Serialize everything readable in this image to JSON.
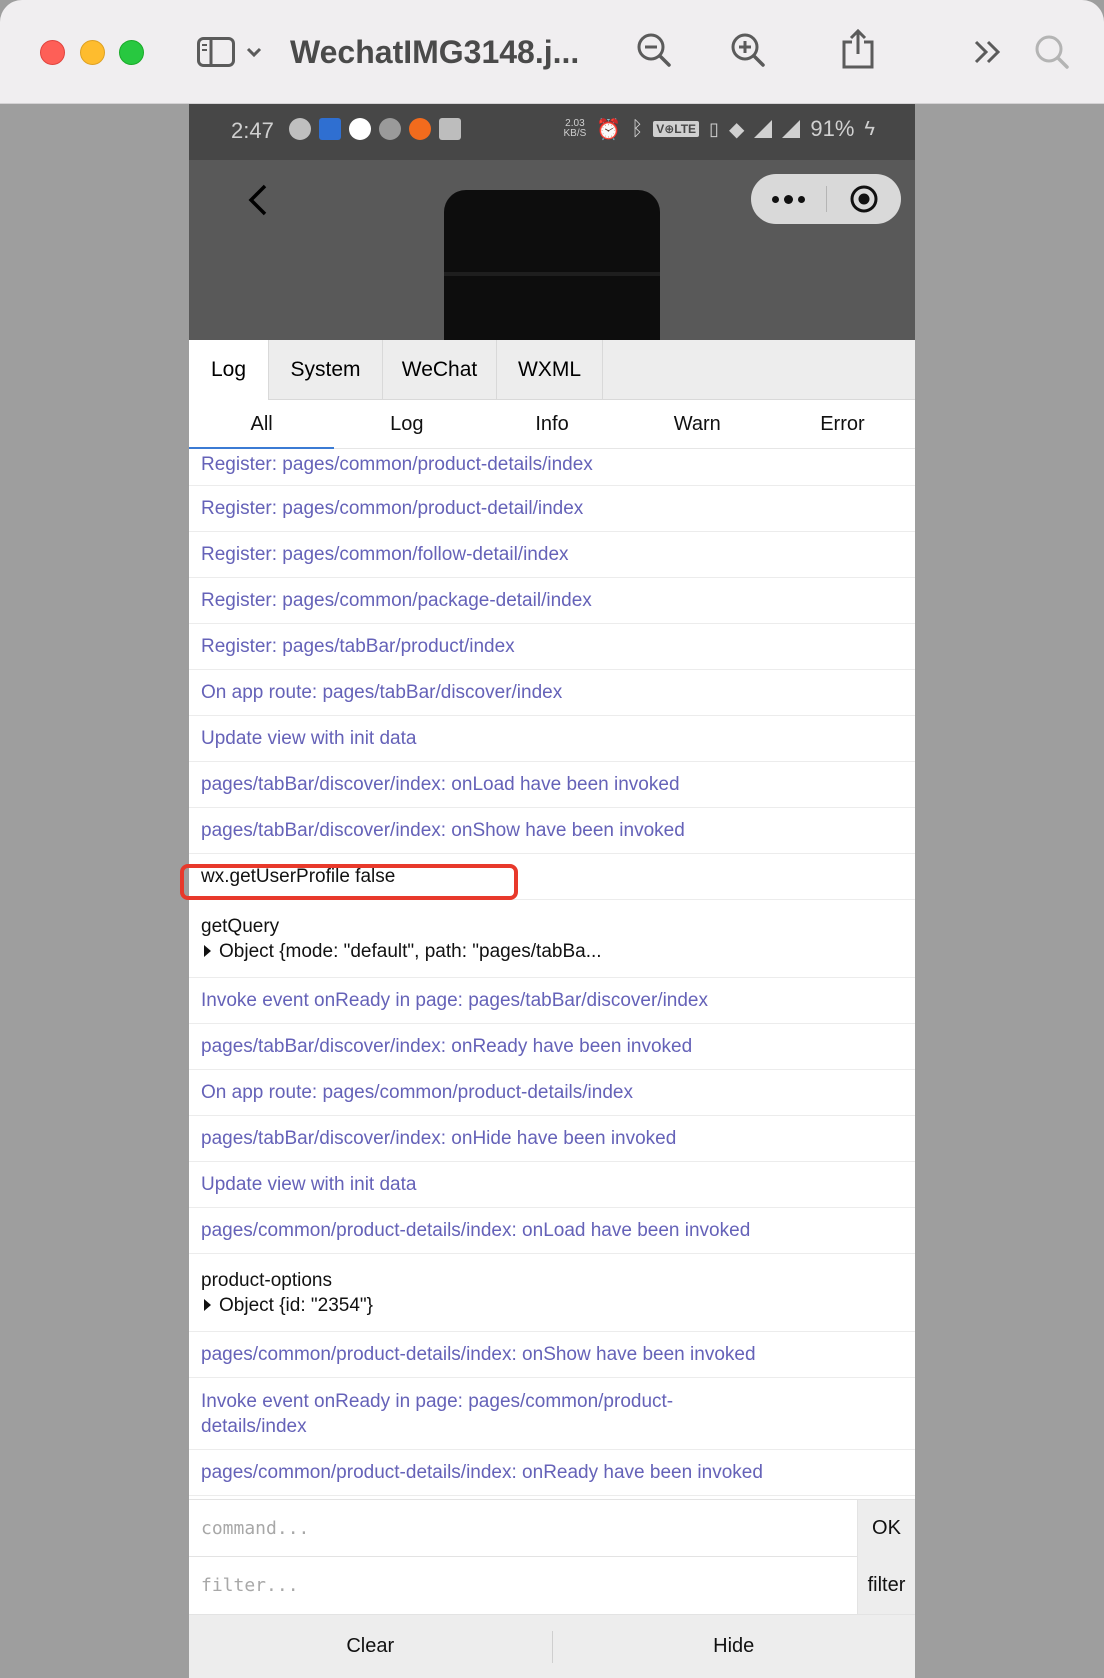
{
  "window": {
    "title": "WechatIMG3148.j...",
    "icons": [
      "sidebar-icon",
      "chevron-down-icon",
      "zoom-out-icon",
      "zoom-in-icon",
      "share-icon",
      "more-chevrons-icon",
      "search-icon"
    ]
  },
  "status_bar": {
    "time": "2:47",
    "speed_top": "2.03",
    "speed_unit": "KB/S",
    "network": "V⊕LTE",
    "battery": "91%"
  },
  "console": {
    "tabs": [
      {
        "label": "Log",
        "active": true
      },
      {
        "label": "System",
        "active": false
      },
      {
        "label": "WeChat",
        "active": false
      },
      {
        "label": "WXML",
        "active": false
      }
    ],
    "subtabs": [
      {
        "label": "All",
        "active": true
      },
      {
        "label": "Log",
        "active": false
      },
      {
        "label": "Info",
        "active": false
      },
      {
        "label": "Warn",
        "active": false
      },
      {
        "label": "Error",
        "active": false
      }
    ],
    "logs": [
      {
        "text": "Register: pages/common/product-details/index",
        "kind": "info"
      },
      {
        "text": "Register: pages/common/product-detail/index",
        "kind": "info"
      },
      {
        "text": "Register: pages/common/follow-detail/index",
        "kind": "info"
      },
      {
        "text": "Register: pages/common/package-detail/index",
        "kind": "info"
      },
      {
        "text": "Register: pages/tabBar/product/index",
        "kind": "info"
      },
      {
        "text": "On app route: pages/tabBar/discover/index",
        "kind": "info"
      },
      {
        "text": "Update view with init data",
        "kind": "info"
      },
      {
        "text": "pages/tabBar/discover/index: onLoad have been invoked",
        "kind": "info"
      },
      {
        "text": "pages/tabBar/discover/index: onShow have been invoked",
        "kind": "info"
      },
      {
        "text": "wx.getUserProfile false",
        "kind": "log"
      },
      {
        "text": "getQuery",
        "kind": "log",
        "object": "Object {mode: \"default\", path: \"pages/tabBa..."
      },
      {
        "text": "Invoke event onReady in page: pages/tabBar/discover/index",
        "kind": "info"
      },
      {
        "text": "pages/tabBar/discover/index: onReady have been invoked",
        "kind": "info"
      },
      {
        "text": "On app route: pages/common/product-details/index",
        "kind": "info"
      },
      {
        "text": "pages/tabBar/discover/index: onHide have been invoked",
        "kind": "info"
      },
      {
        "text": "Update view with init data",
        "kind": "info"
      },
      {
        "text": "pages/common/product-details/index: onLoad have been invoked",
        "kind": "info"
      },
      {
        "text": "product-options",
        "kind": "log",
        "object": "Object {id: \"2354\"}"
      },
      {
        "text": "pages/common/product-details/index: onShow have been invoked",
        "kind": "info"
      },
      {
        "text": "Invoke event onReady in page: pages/common/product-details/index",
        "kind": "info",
        "line2": "details/index",
        "line1": "Invoke event onReady in page: pages/common/product-"
      },
      {
        "text": "pages/common/product-details/index: onReady have been invoked",
        "kind": "info"
      }
    ],
    "command_placeholder": "command...",
    "command_ok": "OK",
    "filter_placeholder": "filter...",
    "filter_button": "filter",
    "clear_label": "Clear",
    "hide_label": "Hide"
  },
  "colors": {
    "info_text": "#6562b8",
    "log_text": "#111111",
    "highlight": "#e8392b",
    "active_tab_underline": "#3b7bd4"
  }
}
